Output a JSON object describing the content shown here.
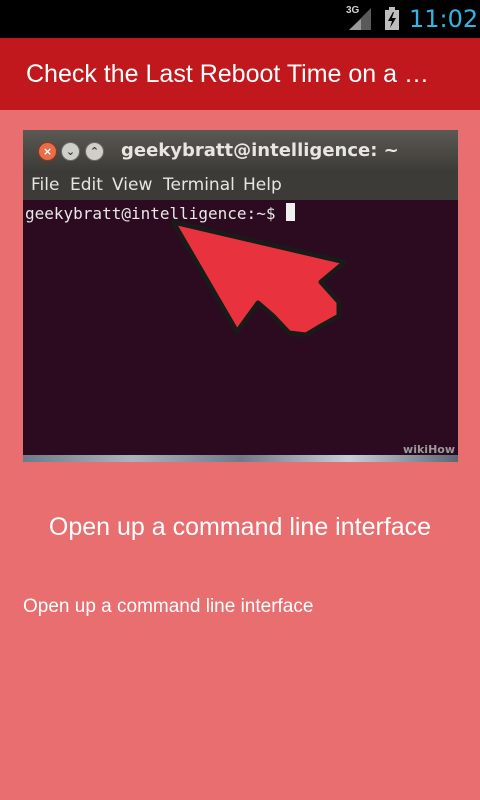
{
  "status_bar": {
    "network_label": "3G",
    "time": "11:02",
    "clock_color": "#33b5e5",
    "icons": [
      "signal-icon",
      "battery-charging-icon"
    ]
  },
  "action_bar": {
    "title": "Check the Last Reboot Time on a …",
    "background_color": "#c0181c"
  },
  "step_image": {
    "window_title": "geekybratt@intelligence: ~",
    "window_buttons": [
      "close-icon",
      "minimize-icon",
      "maximize-icon"
    ],
    "menu": [
      "File",
      "Edit",
      "View",
      "Terminal",
      "Help"
    ],
    "prompt": "geekybratt@intelligence:~$",
    "watermark": "wikiHow",
    "arrow_color": "#e8323e"
  },
  "step": {
    "title": "Open up a command line interface",
    "description": "Open up a command line interface"
  },
  "page_background": "#e86e6f"
}
